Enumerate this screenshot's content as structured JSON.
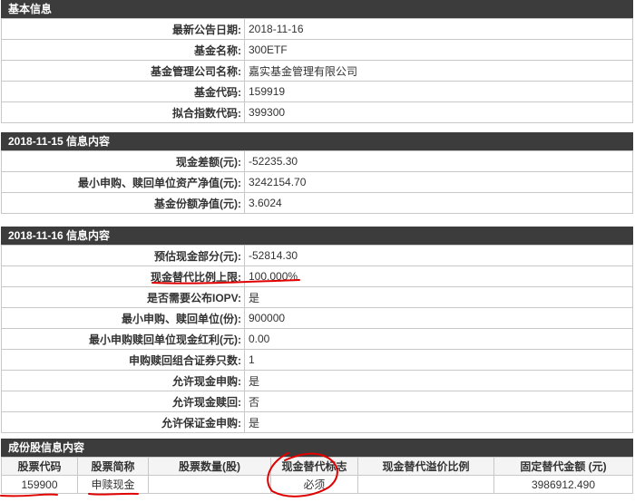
{
  "basic": {
    "title": "基本信息",
    "rows": [
      {
        "label": "最新公告日期:",
        "value": "2018-11-16"
      },
      {
        "label": "基金名称:",
        "value": "300ETF"
      },
      {
        "label": "基金管理公司名称:",
        "value": "嘉实基金管理有限公司"
      },
      {
        "label": "基金代码:",
        "value": "159919"
      },
      {
        "label": "拟合指数代码:",
        "value": "399300"
      }
    ]
  },
  "info1115": {
    "title": "2018-11-15 信息内容",
    "rows": [
      {
        "label": "现金差额(元):",
        "value": "-52235.30"
      },
      {
        "label": "最小申购、赎回单位资产净值(元):",
        "value": "3242154.70"
      },
      {
        "label": "基金份额净值(元):",
        "value": "3.6024"
      }
    ]
  },
  "info1116": {
    "title": "2018-11-16 信息内容",
    "rows": [
      {
        "label": "预估现金部分(元):",
        "value": "-52814.30"
      },
      {
        "label": "现金替代比例上限:",
        "value": "100.000%"
      },
      {
        "label": "是否需要公布IOPV:",
        "value": "是"
      },
      {
        "label": "最小申购、赎回单位(份):",
        "value": "900000"
      },
      {
        "label": "最小申购赎回单位现金红利(元):",
        "value": "0.00"
      },
      {
        "label": "申购赎回组合证券只数:",
        "value": "1"
      },
      {
        "label": "允许现金申购:",
        "value": "是"
      },
      {
        "label": "允许现金赎回:",
        "value": "否"
      },
      {
        "label": "允许保证金申购:",
        "value": "是"
      }
    ]
  },
  "components": {
    "title": "成份股信息内容",
    "headers": [
      "股票代码",
      "股票简称",
      "股票数量(股)",
      "现金替代标志",
      "现金替代溢价比例",
      "固定替代金额 (元)"
    ],
    "rows": [
      [
        "159900",
        "申赎现金",
        "",
        "必须",
        "",
        "3986912.490"
      ]
    ]
  },
  "colors": {
    "header_bg": "#3c3c3c",
    "border": "#c8c8c8",
    "annotation": "#e00000"
  }
}
